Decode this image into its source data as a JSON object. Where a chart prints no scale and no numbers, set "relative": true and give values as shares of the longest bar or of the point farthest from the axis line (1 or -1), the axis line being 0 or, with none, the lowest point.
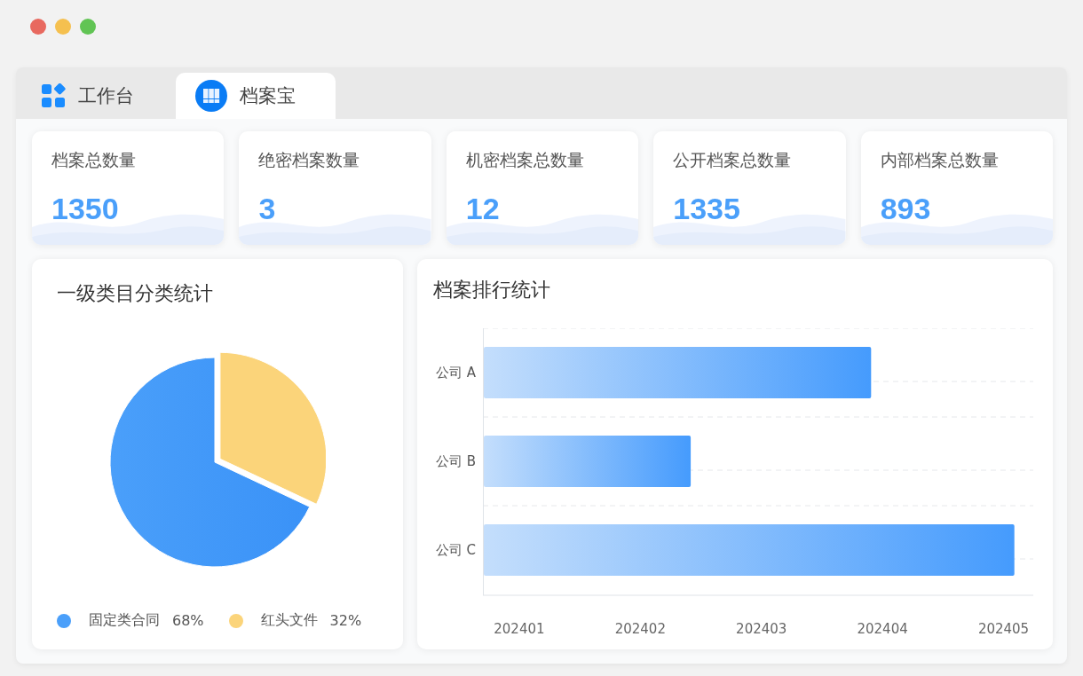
{
  "window": {
    "controls": [
      {
        "color": "#e8695f"
      },
      {
        "color": "#f5c04f"
      },
      {
        "color": "#61c454"
      }
    ]
  },
  "tabs": [
    {
      "label": "工作台",
      "selected": false,
      "kind": "grid"
    },
    {
      "label": "档案宝",
      "selected": true,
      "kind": "archive"
    }
  ],
  "stats": [
    {
      "label": "档案总数量",
      "value": "1350"
    },
    {
      "label": "绝密档案数量",
      "value": "3"
    },
    {
      "label": "机密档案总数量",
      "value": "12"
    },
    {
      "label": "公开档案总数量",
      "value": "1335"
    },
    {
      "label": "内部档案总数量",
      "value": "893"
    }
  ],
  "pie_panel": {
    "chart_data": {
      "type": "pie",
      "title": "一级类目分类统计",
      "categories": [
        "固定类合同",
        "红头文件"
      ],
      "values": [
        68,
        32
      ]
    },
    "legend": [
      {
        "percent": "68%",
        "color": "#4a9ffa"
      },
      {
        "percent": "32%",
        "color": "#fbd47a"
      }
    ]
  },
  "bar_panel": {
    "chart_data": {
      "type": "bar",
      "orientation": "horizontal",
      "title": "档案排行统计",
      "categories": [
        "公司 A",
        "公司 B",
        "公司 C"
      ],
      "values": [
        0.73,
        0.39,
        1
      ],
      "relative": true
    },
    "x_axis_labels": [
      "202401",
      "202402",
      "202403",
      "202404",
      "202405"
    ]
  }
}
